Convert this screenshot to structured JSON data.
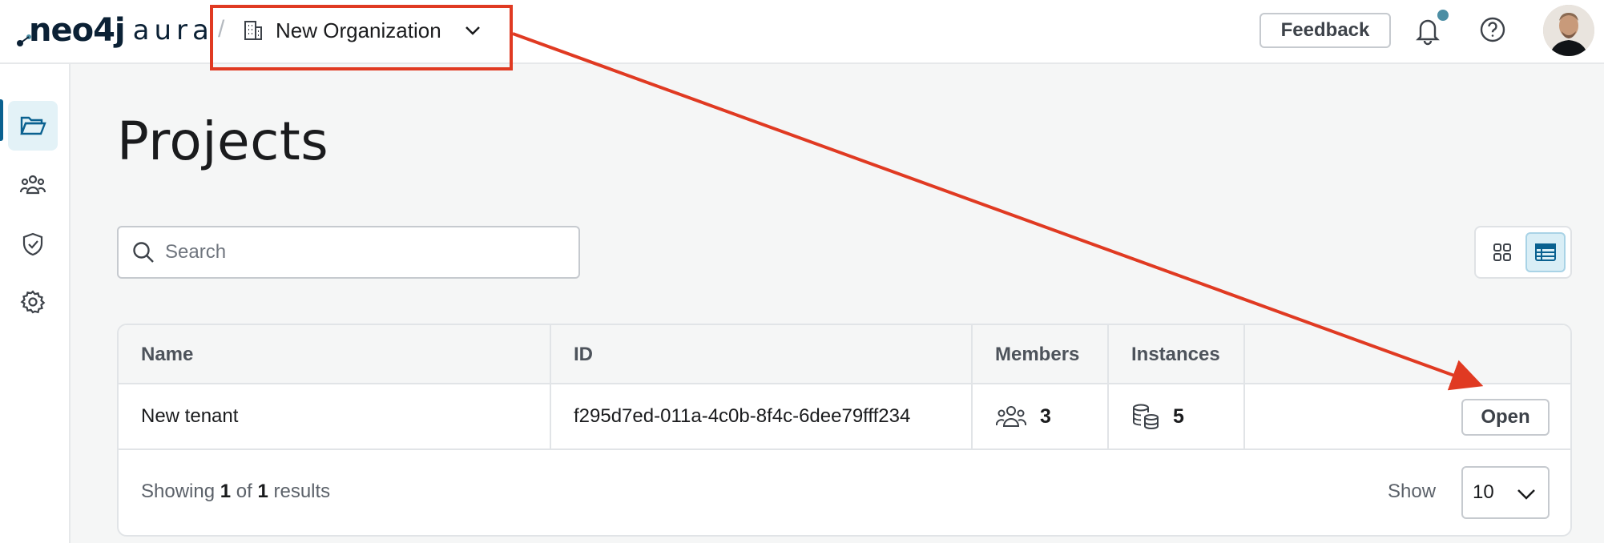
{
  "app": {
    "logo_primary": "neo4j",
    "logo_secondary": "aura",
    "breadcrumb_separator": "/"
  },
  "org_switcher": {
    "label": "New Organization",
    "icon": "building-icon"
  },
  "header": {
    "feedback_label": "Feedback",
    "notifications_icon": "bell-icon",
    "help_icon": "help-icon",
    "notification_dot_color": "#4c8ea4"
  },
  "sidebar": {
    "items": [
      {
        "name": "projects",
        "icon": "folder-icon",
        "active": true
      },
      {
        "name": "users",
        "icon": "users-icon",
        "active": false
      },
      {
        "name": "security",
        "icon": "shield-check-icon",
        "active": false
      },
      {
        "name": "settings",
        "icon": "gear-icon",
        "active": false
      }
    ]
  },
  "page": {
    "title": "Projects"
  },
  "search": {
    "placeholder": "Search",
    "value": ""
  },
  "view_toggle": {
    "options": [
      "grid-view-icon",
      "list-view-icon"
    ],
    "selected": "list-view-icon"
  },
  "table": {
    "columns": [
      "Name",
      "ID",
      "Members",
      "Instances",
      ""
    ],
    "rows": [
      {
        "name": "New tenant",
        "id": "f295d7ed-011a-4c0b-8f4c-6dee79fff234",
        "members": "3",
        "instances": "5",
        "action": "Open"
      }
    ],
    "footer": {
      "showing_prefix": "Showing",
      "showing_current": "1",
      "showing_of": "of",
      "showing_total": "1",
      "showing_suffix": "results",
      "show_label": "Show",
      "page_size": "10"
    }
  },
  "colors": {
    "annotation": "#e03a22",
    "accent": "#0a6190",
    "active_bg": "#e3f2f7"
  }
}
